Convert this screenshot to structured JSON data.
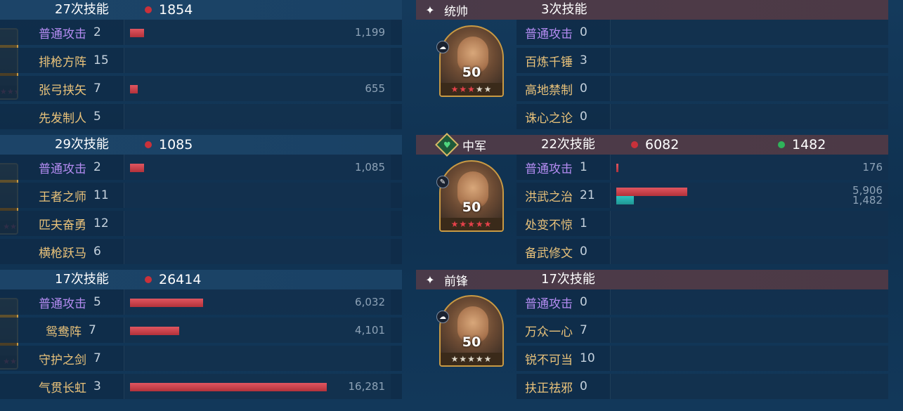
{
  "left_column": {
    "groups": [
      {
        "skill_casts": "27次技能",
        "damage": "1854",
        "portrait_stars": "★★★",
        "skills": [
          {
            "name": "普通攻击",
            "count": "2",
            "value": "1,199",
            "bar_fraction": 0.07,
            "normal": true
          },
          {
            "name": "排枪方阵",
            "count": "15",
            "value": "",
            "bar_fraction": 0
          },
          {
            "name": "张弓挟矢",
            "count": "7",
            "value": "655",
            "bar_fraction": 0.04
          },
          {
            "name": "先发制人",
            "count": "5",
            "value": "",
            "bar_fraction": 0
          }
        ]
      },
      {
        "skill_casts": "29次技能",
        "damage": "1085",
        "portrait_stars": "★★",
        "skills": [
          {
            "name": "普通攻击",
            "count": "2",
            "value": "1,085",
            "bar_fraction": 0.07,
            "normal": true
          },
          {
            "name": "王者之师",
            "count": "11",
            "value": "",
            "bar_fraction": 0
          },
          {
            "name": "匹夫奋勇",
            "count": "12",
            "value": "",
            "bar_fraction": 0
          },
          {
            "name": "横枪跃马",
            "count": "6",
            "value": "",
            "bar_fraction": 0
          }
        ]
      },
      {
        "skill_casts": "17次技能",
        "damage": "26414",
        "portrait_stars": "★★",
        "skills": [
          {
            "name": "普通攻击",
            "count": "5",
            "value": "6,032",
            "bar_fraction": 0.37,
            "normal": true
          },
          {
            "name": "鸳鸯阵",
            "count": "7",
            "value": "4,101",
            "bar_fraction": 0.25
          },
          {
            "name": "守护之剑",
            "count": "7",
            "value": "",
            "bar_fraction": 0
          },
          {
            "name": "气贯长虹",
            "count": "3",
            "value": "16,281",
            "bar_fraction": 1.0
          }
        ]
      }
    ]
  },
  "right_column": {
    "groups": [
      {
        "role": "统帅",
        "role_icon": "sparkle-icon",
        "skill_casts": "3次技能",
        "level": "50",
        "stars_red": "★★★",
        "stars_grey": "★★",
        "badge_icon": "cloud-icon",
        "skills": [
          {
            "name": "普通攻击",
            "count": "0",
            "value": "",
            "bar_fraction": 0,
            "normal": true
          },
          {
            "name": "百炼千锤",
            "count": "3",
            "value": "",
            "bar_fraction": 0
          },
          {
            "name": "高地禁制",
            "count": "0",
            "value": "",
            "bar_fraction": 0
          },
          {
            "name": "诛心之论",
            "count": "0",
            "value": "",
            "bar_fraction": 0
          }
        ]
      },
      {
        "role": "中军",
        "role_icon": "heart-emblem-icon",
        "skill_casts": "22次技能",
        "damage": "6082",
        "heal": "1482",
        "level": "50",
        "stars_red": "★★★★★",
        "stars_grey": "",
        "badge_icon": "feather-icon",
        "skills": [
          {
            "name": "普通攻击",
            "count": "1",
            "value": "176",
            "bar_fraction": 0.03,
            "normal": true
          },
          {
            "name": "洪武之治",
            "count": "21",
            "value": "5,906",
            "value2": "1,482",
            "bar_fraction": 1.0,
            "bar2_fraction": 0.25
          },
          {
            "name": "处变不惊",
            "count": "1",
            "value": "",
            "bar_fraction": 0
          },
          {
            "name": "备武修文",
            "count": "0",
            "value": "",
            "bar_fraction": 0
          }
        ]
      },
      {
        "role": "前锋",
        "role_icon": "sparkle-icon",
        "skill_casts": "17次技能",
        "level": "50",
        "stars_red": "",
        "stars_grey": "★★★★★",
        "badge_icon": "cloud-icon",
        "skills": [
          {
            "name": "普通攻击",
            "count": "0",
            "value": "",
            "bar_fraction": 0,
            "normal": true
          },
          {
            "name": "万众一心",
            "count": "7",
            "value": "",
            "bar_fraction": 0
          },
          {
            "name": "锐不可当",
            "count": "10",
            "value": "",
            "bar_fraction": 0
          },
          {
            "name": "扶正祛邪",
            "count": "0",
            "value": "",
            "bar_fraction": 0
          }
        ]
      }
    ]
  },
  "colors": {
    "damage_bar": "#c9313a",
    "heal_bar": "#2fc3c0",
    "skill_name": "#e9c27a",
    "normal_attack": "#b48cf2"
  }
}
